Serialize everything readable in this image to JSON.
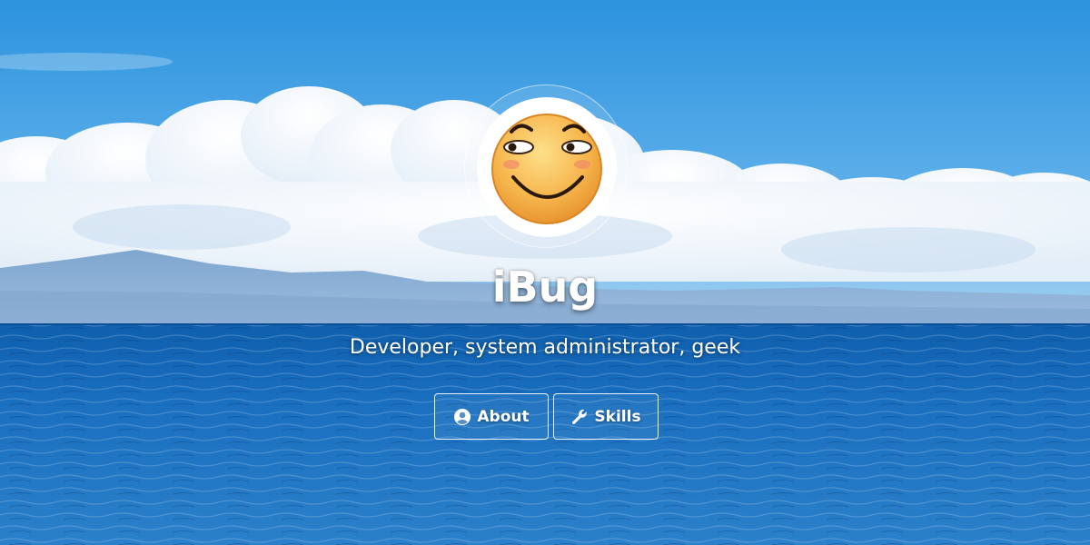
{
  "site": {
    "title": "iBug",
    "tagline": "Developer, system administrator, geek"
  },
  "avatar": {
    "icon": "smirking-emoji-face"
  },
  "actions": [
    {
      "label": "About",
      "icon": "user-circle-icon"
    },
    {
      "label": "Skills",
      "icon": "wrench-icon"
    }
  ],
  "colors": {
    "sky_top": "#2a96e0",
    "sky_bottom": "#8cc6ee",
    "sea_top": "#1565b8",
    "sea_bottom": "#2a7fc9",
    "text": "#ffffff",
    "emoji_face": "#f2b04a"
  }
}
